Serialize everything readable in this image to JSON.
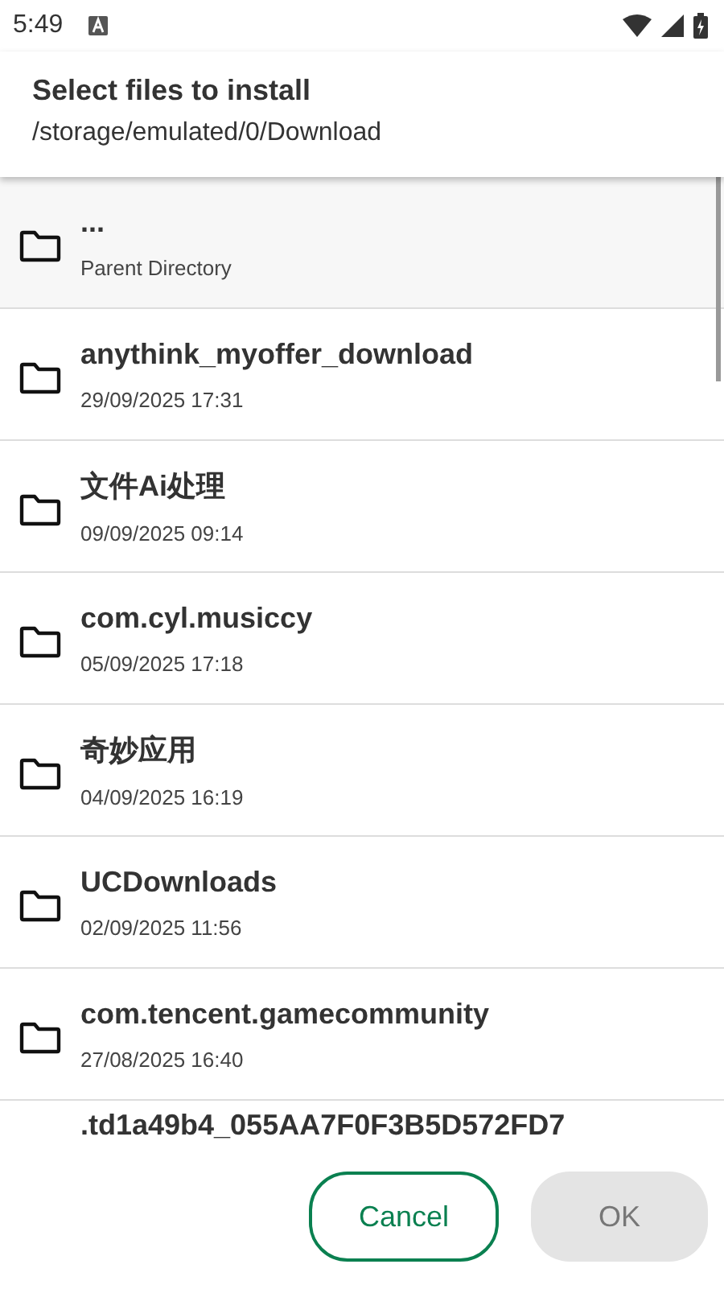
{
  "status_bar": {
    "time": "5:49"
  },
  "header": {
    "title": "Select files to install",
    "path": "/storage/emulated/0/Download"
  },
  "items": [
    {
      "kind": "parent",
      "name": "...",
      "detail": "Parent Directory"
    },
    {
      "kind": "folder",
      "name": "anythink_myoffer_download",
      "detail": "29/09/2025 17:31"
    },
    {
      "kind": "folder",
      "name": "文件Ai处理",
      "detail": "09/09/2025 09:14"
    },
    {
      "kind": "folder",
      "name": "com.cyl.musiccy",
      "detail": "05/09/2025 17:18"
    },
    {
      "kind": "folder",
      "name": "奇妙应用",
      "detail": "04/09/2025 16:19"
    },
    {
      "kind": "folder",
      "name": "UCDownloads",
      "detail": "02/09/2025 11:56"
    },
    {
      "kind": "folder",
      "name": "com.tencent.gamecommunity",
      "detail": "27/08/2025 16:40"
    },
    {
      "kind": "cut",
      "name": ".td1a49b4_055AA7F0F3B5D572FD7"
    }
  ],
  "buttons": [
    {
      "label": "Cancel",
      "disabled": false
    },
    {
      "label": "OK",
      "disabled": true
    }
  ]
}
